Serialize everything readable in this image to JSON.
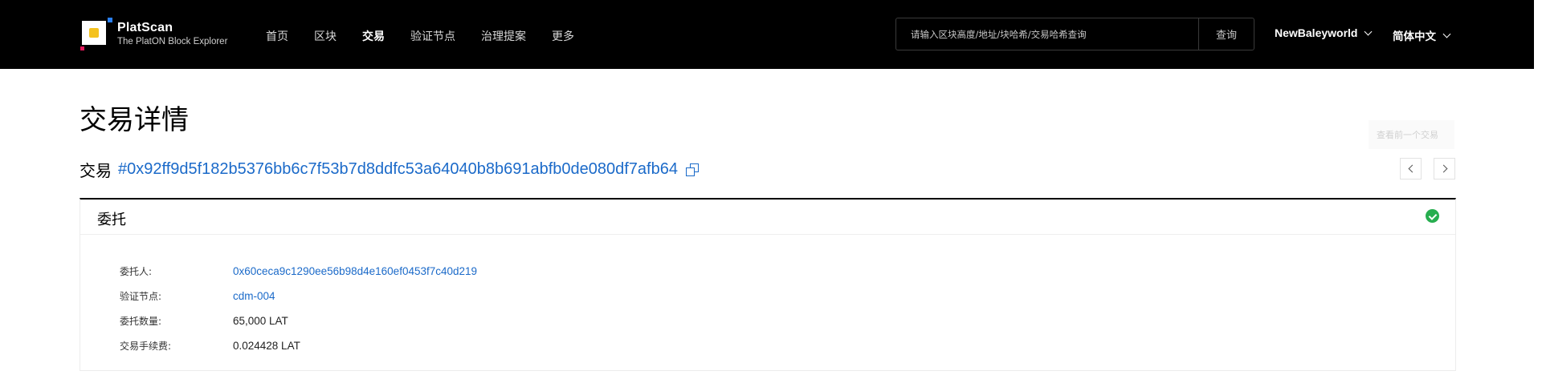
{
  "header": {
    "logo": {
      "title": "PlatScan",
      "subtitle": "The PlatON Block Explorer"
    },
    "nav": [
      {
        "label": "首页",
        "active": false
      },
      {
        "label": "区块",
        "active": false
      },
      {
        "label": "交易",
        "active": true
      },
      {
        "label": "验证节点",
        "active": false
      },
      {
        "label": "治理提案",
        "active": false
      },
      {
        "label": "更多",
        "active": false
      }
    ],
    "search": {
      "placeholder": "请输入区块高度/地址/块哈希/交易哈希查询",
      "button_label": "查询"
    },
    "network": "NewBaleyworld",
    "language": "简体中文"
  },
  "page": {
    "title": "交易详情",
    "tx_label": "交易",
    "tx_hash": "#0x92ff9d5f182b5376bb6c7f53b7d8ddfc53a64040b8b691abfb0de080df7afb64",
    "prev_tooltip": "查看前一个交易"
  },
  "card": {
    "title": "委托",
    "status": "success",
    "rows": [
      {
        "label": "委托人:",
        "value": "0x60ceca9c1290ee56b98d4e160ef0453f7c40d219",
        "link": true
      },
      {
        "label": "验证节点:",
        "value": "cdm-004",
        "link": true
      },
      {
        "label": "委托数量:",
        "value": "65,000 LAT",
        "link": false
      },
      {
        "label": "交易手续费:",
        "value": "0.024428 LAT",
        "link": false
      }
    ]
  },
  "colors": {
    "header_bg": "#000000",
    "link": "#1b6ac9",
    "success": "#27ae4f",
    "logo_yellow": "#f4c21e"
  },
  "icons": [
    "logo-icon",
    "chevron-down-icon",
    "copy-icon",
    "chevron-left-icon",
    "chevron-right-icon",
    "check-circle-icon"
  ]
}
